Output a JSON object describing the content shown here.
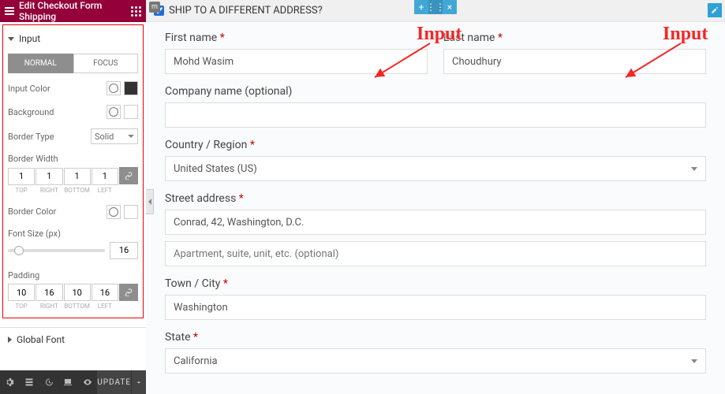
{
  "panel": {
    "title": "Edit Checkout Form Shipping",
    "input_section": "Input",
    "tabs": {
      "normal": "NORMAL",
      "focus": "FOCUS"
    },
    "input_color": "Input Color",
    "background": "Background",
    "border_type": "Border Type",
    "border_type_value": "Solid",
    "border_width": "Border Width",
    "bw": {
      "top": "1",
      "right": "1",
      "bottom": "1",
      "left": "1"
    },
    "bw_labels": {
      "top": "TOP",
      "right": "RIGHT",
      "bottom": "BOTTOM",
      "left": "LEFT"
    },
    "border_color": "Border Color",
    "font_size": "Font Size (px)",
    "font_size_value": "16",
    "padding": "Padding",
    "pd": {
      "top": "10",
      "right": "16",
      "bottom": "10",
      "left": "16"
    },
    "global_font": "Global Font",
    "update": "UPDATE"
  },
  "annotations": {
    "input1": "Input",
    "input2": "Input"
  },
  "colors": {
    "input_color": "#333333",
    "border_color": "#ffffff"
  },
  "form": {
    "heading": "SHIP TO A DIFFERENT ADDRESS?",
    "first_name_label": "First name",
    "first_name_value": "Mohd Wasim",
    "last_name_label": "Last name",
    "last_name_value": "Choudhury",
    "company_label": "Company name (optional)",
    "company_value": "",
    "country_label": "Country / Region",
    "country_value": "United States (US)",
    "street_label": "Street address",
    "street1_value": "Conrad, 42, Washington, D.C.",
    "street2_placeholder": "Apartment, suite, unit, etc. (optional)",
    "city_label": "Town / City",
    "city_value": "Washington",
    "state_label": "State",
    "state_value": "California",
    "req": "*"
  }
}
